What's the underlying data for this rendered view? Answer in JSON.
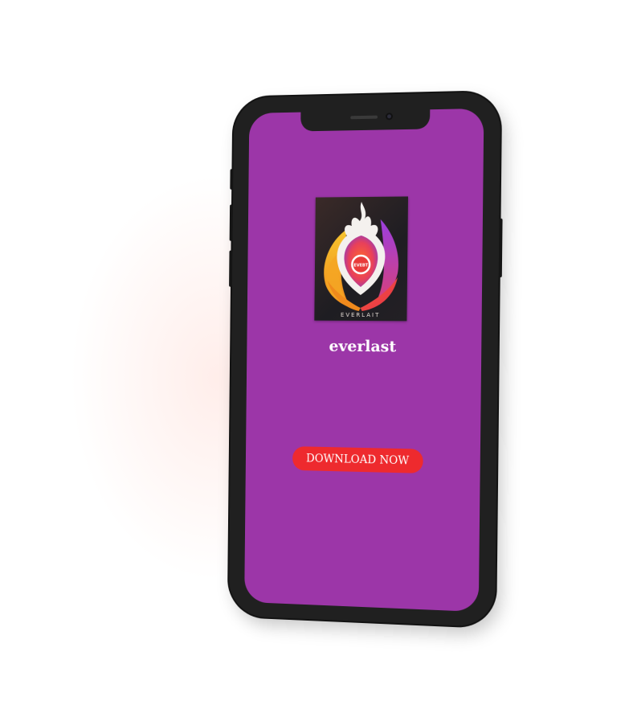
{
  "app": {
    "name": "everlast",
    "logo_wordmark": "EVERLAIT",
    "logo_badge": "EVEBT"
  },
  "actions": {
    "download_label": "DOWNLOAD NOW"
  },
  "colors": {
    "screen_background": "#9c36a8",
    "download_button": "#ee2a2e",
    "phone_frame": "#202020"
  },
  "icons": {
    "logo": "flame-shield-icon"
  }
}
